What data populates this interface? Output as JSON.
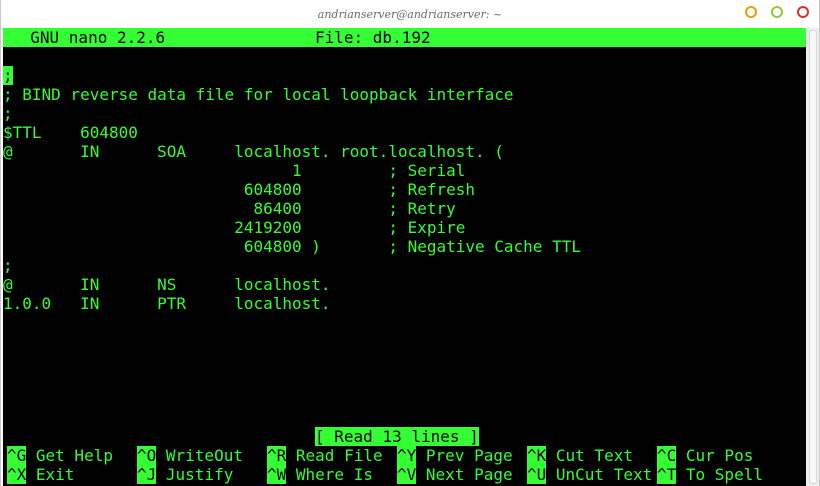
{
  "window": {
    "title": "andrianserver@andrianserver: ~"
  },
  "nano": {
    "version": "  GNU nano 2.2.6",
    "file": "File: db.192"
  },
  "buffer": {
    "lines": [
      "",
      ";",
      "; BIND reverse data file for local loopback interface",
      ";",
      "$TTL    604800",
      "@       IN      SOA     localhost. root.localhost. (",
      "                              1         ; Serial",
      "                         604800         ; Refresh",
      "                          86400         ; Retry",
      "                        2419200         ; Expire",
      "                         604800 )       ; Negative Cache TTL",
      ";",
      "@       IN      NS      localhost.",
      "1.0.0   IN      PTR     localhost."
    ]
  },
  "status": "[ Read 13 lines ]",
  "shortcuts": [
    {
      "key": "^G",
      "label": " Get Help"
    },
    {
      "key": "^O",
      "label": " WriteOut"
    },
    {
      "key": "^R",
      "label": " Read File"
    },
    {
      "key": "^Y",
      "label": " Prev Page"
    },
    {
      "key": "^K",
      "label": " Cut Text"
    },
    {
      "key": "^C",
      "label": " Cur Pos"
    },
    {
      "key": "^X",
      "label": " Exit"
    },
    {
      "key": "^J",
      "label": " Justify"
    },
    {
      "key": "^W",
      "label": " Where Is"
    },
    {
      "key": "^V",
      "label": " Next Page"
    },
    {
      "key": "^U",
      "label": " UnCut Text"
    },
    {
      "key": "^T",
      "label": " To Spell"
    }
  ],
  "colors": {
    "terminal_bg": "#000000",
    "terminal_fg": "#33ff33",
    "close": "#e0302a",
    "minimize": "#e8a000",
    "maximize": "#9ac43c"
  },
  "icons": [
    "minimize-icon",
    "maximize-icon",
    "close-icon"
  ]
}
